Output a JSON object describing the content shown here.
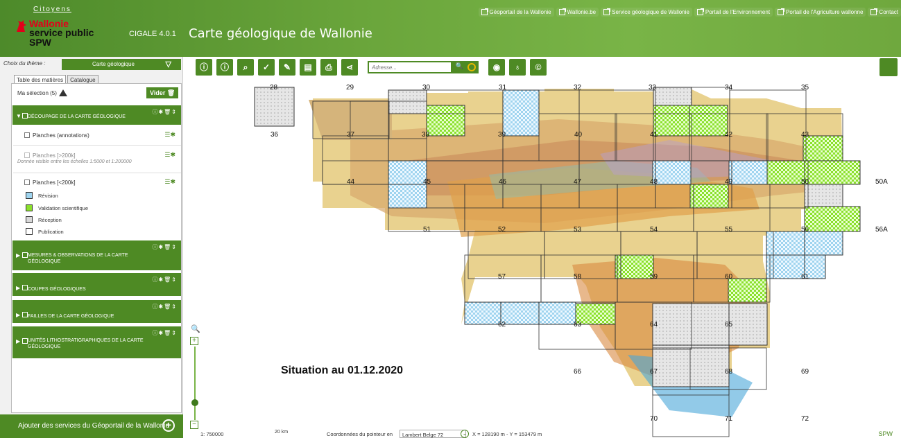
{
  "header": {
    "citoyens": "Citoyens",
    "logo": {
      "line1": "Wallonie",
      "line2": "service public",
      "line3": "SPW"
    },
    "version": "CIGALE 4.0.1",
    "title": "Carte géologique de Wallonie",
    "links": [
      "Géoportail de la Wallonie",
      "Wallonie.be",
      "Service géologique de Wallonie",
      "Portail de l'Environnement",
      "Portail de l'Agriculture wallonne",
      "Contact"
    ]
  },
  "sidebar": {
    "theme_label": "Choix du thème :",
    "theme_value": "Carte géologique",
    "tabs": [
      "Table des matières",
      "Catalogue"
    ],
    "selection": "Ma sélection (5)",
    "vider": "Vider",
    "groups": [
      {
        "title": "Découpage de la carte géologique"
      },
      {
        "title": "Mesures & observations de la carte géologique"
      },
      {
        "title": "Coupes géologiques"
      },
      {
        "title": "Failles de la carte géologique"
      },
      {
        "title": "Unités lithostratigraphiques de la carte géologique"
      }
    ],
    "layers": [
      {
        "label": "Planches (annotations)"
      },
      {
        "label": "Planches [>200k]",
        "note": "Donnée visible entre les échelles 1:5000 et 1:200000"
      },
      {
        "label": "Planches [<200k]"
      }
    ],
    "legend": [
      {
        "label": "Révision",
        "color": "#9fd4ef"
      },
      {
        "label": "Validation scientifique",
        "color": "#8be02c"
      },
      {
        "label": "Réception",
        "color": "#d9d9d9"
      },
      {
        "label": "Publication",
        "color": "#ffffff"
      }
    ],
    "add_services": "Ajouter des services du Géoportail de la Wallonie"
  },
  "toolbar": {
    "search_placeholder": "Adresse..."
  },
  "map": {
    "situation": "Situation au 01.12.2020",
    "sheets": [
      "28",
      "29",
      "30",
      "31",
      "32",
      "33",
      "34",
      "35",
      "36",
      "37",
      "38",
      "39",
      "40",
      "41",
      "42",
      "43",
      "44",
      "45",
      "46",
      "47",
      "48",
      "49",
      "50",
      "50A",
      "51",
      "52",
      "53",
      "54",
      "55",
      "56",
      "56A",
      "57",
      "58",
      "59",
      "60",
      "61",
      "62",
      "63",
      "64",
      "65",
      "66",
      "67",
      "68",
      "69",
      "70",
      "71",
      "72"
    ]
  },
  "status": {
    "scale": "1: 750000",
    "km": "20 km",
    "coord_label": "Coordonnées du pointeur en",
    "projection": "Lambert Belge 72",
    "xy": "X = 128190 m  - Y = 153479 m",
    "brand": "SPW"
  }
}
